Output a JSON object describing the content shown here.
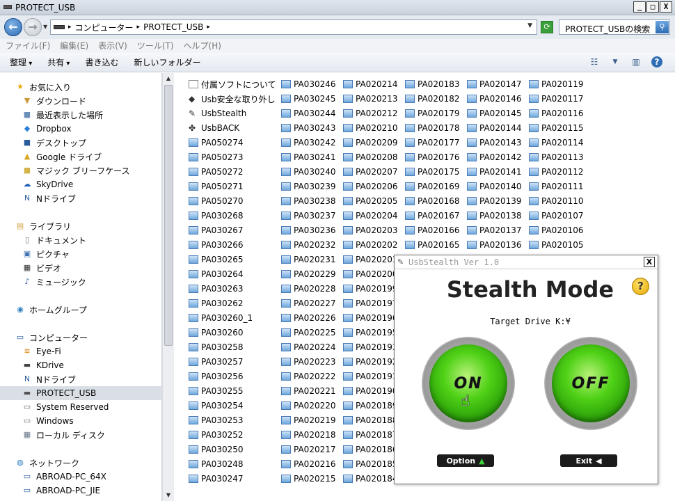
{
  "window": {
    "title": "PROTECT_USB",
    "controls": {
      "minimize": "_",
      "maximize": "□",
      "close": "X"
    }
  },
  "address": {
    "path": [
      "コンピューター",
      "PROTECT_USB"
    ],
    "search_placeholder": "PROTECT_USBの検索"
  },
  "menu": [
    "ファイル(F)",
    "編集(E)",
    "表示(V)",
    "ツール(T)",
    "ヘルプ(H)"
  ],
  "toolbar": {
    "organize": "整理",
    "share": "共有",
    "burn": "書き込む",
    "new_folder": "新しいフォルダー"
  },
  "sidebar": [
    {
      "label": "お気に入り",
      "indent": 0,
      "icon": "star-icon",
      "glyph": "★",
      "color": "#e6a800"
    },
    {
      "label": "ダウンロード",
      "indent": 1,
      "icon": "download-folder-icon",
      "glyph": "▼",
      "color": "#c99a3a"
    },
    {
      "label": "最近表示した場所",
      "indent": 1,
      "icon": "recent-places-icon",
      "glyph": "■",
      "color": "#6b8fb8"
    },
    {
      "label": "Dropbox",
      "indent": 1,
      "icon": "dropbox-icon",
      "glyph": "◆",
      "color": "#2b7fd6"
    },
    {
      "label": "デスクトップ",
      "indent": 1,
      "icon": "desktop-icon",
      "glyph": "■",
      "color": "#2a5d9c"
    },
    {
      "label": "Google ドライブ",
      "indent": 1,
      "icon": "google-drive-icon",
      "glyph": "▲",
      "color": "#d8a51c"
    },
    {
      "label": "マジック ブリーフケース",
      "indent": 1,
      "icon": "briefcase-icon",
      "glyph": "■",
      "color": "#d4b44a"
    },
    {
      "label": "SkyDrive",
      "indent": 1,
      "icon": "skydrive-icon",
      "glyph": "☁",
      "color": "#1c5fb4"
    },
    {
      "label": "Nドライブ",
      "indent": 1,
      "icon": "n-drive-icon",
      "glyph": "N",
      "color": "#2a5d9c"
    },
    {
      "label": "ライブラリ",
      "indent": 0,
      "icon": "library-icon",
      "glyph": "▤",
      "color": "#d4a84a"
    },
    {
      "label": "ドキュメント",
      "indent": 1,
      "icon": "documents-icon",
      "glyph": "▯",
      "color": "#777"
    },
    {
      "label": "ピクチャ",
      "indent": 1,
      "icon": "pictures-icon",
      "glyph": "▣",
      "color": "#3a6fb0"
    },
    {
      "label": "ビデオ",
      "indent": 1,
      "icon": "videos-icon",
      "glyph": "▦",
      "color": "#333"
    },
    {
      "label": "ミュージック",
      "indent": 1,
      "icon": "music-icon",
      "glyph": "♪",
      "color": "#2a5d9c"
    },
    {
      "label": "ホームグループ",
      "indent": 0,
      "icon": "homegroup-icon",
      "glyph": "◉",
      "color": "#2f7fc0"
    },
    {
      "label": "コンピューター",
      "indent": 0,
      "icon": "computer-icon",
      "glyph": "▭",
      "color": "#2a5d9c"
    },
    {
      "label": "Eye-Fi",
      "indent": 1,
      "icon": "wifi-icon",
      "glyph": "≋",
      "color": "#e07a00"
    },
    {
      "label": "KDrive",
      "indent": 1,
      "icon": "drive-icon",
      "glyph": "▬",
      "color": "#444"
    },
    {
      "label": "Nドライブ",
      "indent": 1,
      "icon": "n-drive-icon",
      "glyph": "N",
      "color": "#2a5d9c"
    },
    {
      "label": "PROTECT_USB",
      "indent": 1,
      "icon": "usb-drive-icon",
      "glyph": "▬",
      "color": "#555",
      "selected": true
    },
    {
      "label": "System Reserved",
      "indent": 1,
      "icon": "drive-icon",
      "glyph": "▭",
      "color": "#666"
    },
    {
      "label": "Windows",
      "indent": 1,
      "icon": "drive-icon",
      "glyph": "▭",
      "color": "#666"
    },
    {
      "label": "ローカル ディスク",
      "indent": 1,
      "icon": "drive-icon",
      "glyph": "▦",
      "color": "#6b7c8a"
    },
    {
      "label": "ネットワーク",
      "indent": 0,
      "icon": "network-icon",
      "glyph": "◍",
      "color": "#2f7fc0"
    },
    {
      "label": "ABROAD-PC_64X",
      "indent": 1,
      "icon": "pc-icon",
      "glyph": "▭",
      "color": "#2a5d9c"
    },
    {
      "label": "ABROAD-PC_JIE",
      "indent": 1,
      "icon": "pc-icon",
      "glyph": "▭",
      "color": "#2a5d9c"
    }
  ],
  "files": [
    [
      "付属ソフトについて",
      "Usb安全な取り外し",
      "UsbStealth",
      "UsbBACK",
      "PA050274",
      "PA050273",
      "PA050272",
      "PA050271",
      "PA050270",
      "PA030268",
      "PA030267",
      "PA030266",
      "PA030265",
      "PA030264",
      "PA030263",
      "PA030262",
      "PA030260_1",
      "PA030260",
      "PA030258",
      "PA030257",
      "PA030256",
      "PA030255",
      "PA030254",
      "PA030253",
      "PA030252",
      "PA030250",
      "PA030248",
      "PA030247"
    ],
    [
      "PA030246",
      "PA030245",
      "PA030244",
      "PA030243",
      "PA030242",
      "PA030241",
      "PA030240",
      "PA030239",
      "PA030238",
      "PA030237",
      "PA030236",
      "PA020232",
      "PA020231",
      "PA020229",
      "PA020228",
      "PA020227",
      "PA020226",
      "PA020225",
      "PA020224",
      "PA020223",
      "PA020222",
      "PA020221",
      "PA020220",
      "PA020219",
      "PA020218",
      "PA020217",
      "PA020216",
      "PA020215"
    ],
    [
      "PA020214",
      "PA020213",
      "PA020212",
      "PA020210",
      "PA020209",
      "PA020208",
      "PA020207",
      "PA020206",
      "PA020205",
      "PA020204",
      "PA020203",
      "PA020202",
      "PA020201",
      "PA020200",
      "PA020199",
      "PA020197",
      "PA020196",
      "PA020195",
      "PA020193",
      "PA020192",
      "PA020191",
      "PA020190",
      "PA020189",
      "PA020188",
      "PA020187",
      "PA020186",
      "PA020185",
      "PA020184"
    ],
    [
      "PA020183",
      "PA020182",
      "PA020179",
      "PA020178",
      "PA020177",
      "PA020176",
      "PA020175",
      "PA020169",
      "PA020168",
      "PA020167",
      "PA020166",
      "PA020165"
    ],
    [
      "PA020147",
      "PA020146",
      "PA020145",
      "PA020144",
      "PA020143",
      "PA020142",
      "PA020141",
      "PA020140",
      "PA020139",
      "PA020138",
      "PA020137",
      "PA020136"
    ],
    [
      "PA020119",
      "PA020117",
      "PA020116",
      "PA020115",
      "PA020114",
      "PA020113",
      "PA020112",
      "PA020111",
      "PA020110",
      "PA020107",
      "PA020106",
      "PA020105"
    ]
  ],
  "dialog": {
    "title": "UsbStealth Ver 1.0",
    "close": "X",
    "heading": "Stealth Mode",
    "help": "?",
    "target_label": "Target Drive",
    "target_drive": "K:¥",
    "on_label": "ON",
    "off_label": "OFF",
    "option_label": "Option",
    "exit_label": "Exit"
  }
}
